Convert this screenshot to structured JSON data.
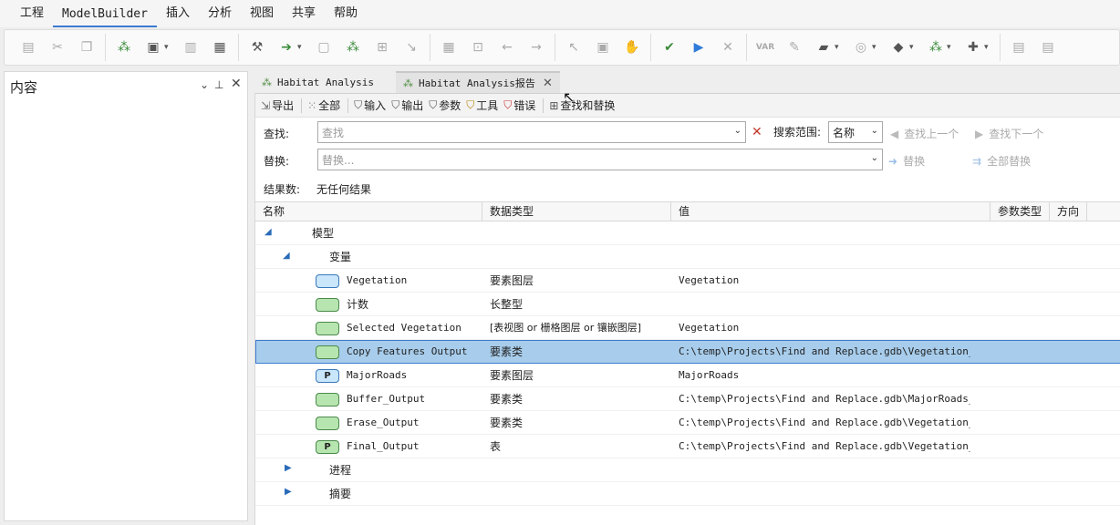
{
  "menubar": {
    "items": [
      "工程",
      "ModelBuilder",
      "插入",
      "分析",
      "视图",
      "共享",
      "帮助"
    ],
    "active": "ModelBuilder"
  },
  "contents_pane": {
    "title": "内容"
  },
  "tabs": [
    {
      "label": "Habitat Analysis",
      "active": false
    },
    {
      "label": "Habitat Analysis报告",
      "active": true
    }
  ],
  "report_toolbar": {
    "buttons": [
      "导出",
      "全部",
      "输入",
      "输出",
      "参数",
      "工具",
      "错误",
      "查找和替换"
    ]
  },
  "find": {
    "label": "查找:",
    "placeholder": "查找",
    "scope_label": "搜索范围:",
    "scope_value": "名称",
    "prev_label": "查找上一个",
    "next_label": "查找下一个"
  },
  "replace": {
    "label": "替换:",
    "placeholder": "替换...",
    "replace_label": "替换",
    "replace_all_label": "全部替换"
  },
  "results": {
    "label": "结果数:",
    "value": "无任何结果"
  },
  "grid": {
    "columns": [
      "名称",
      "数据类型",
      "值",
      "参数类型",
      "方向"
    ],
    "tree": {
      "model_label": "模型",
      "variables_label": "变量",
      "process_label": "进程",
      "summary_label": "摘要"
    },
    "rows": [
      {
        "name": "Vegetation",
        "datatype": "要素图层",
        "value": "Vegetation",
        "icon": "blue"
      },
      {
        "name": "计数",
        "datatype": "长整型",
        "value": "",
        "icon": "green"
      },
      {
        "name": "Selected Vegetation",
        "datatype": "[表视图 or 栅格图层 or 镶嵌图层]",
        "value": "Vegetation",
        "icon": "green"
      },
      {
        "name": "Copy Features Output",
        "datatype": "要素类",
        "value": "C:\\temp\\Projects\\Find and Replace.gdb\\Vegetation_Co…",
        "icon": "green",
        "selected": true
      },
      {
        "name": "MajorRoads",
        "datatype": "要素图层",
        "value": "MajorRoads",
        "icon": "blue-p"
      },
      {
        "name": "Buffer_Output",
        "datatype": "要素类",
        "value": "C:\\temp\\Projects\\Find and Replace.gdb\\MajorRoads_Bu…",
        "icon": "green"
      },
      {
        "name": "Erase_Output",
        "datatype": "要素类",
        "value": "C:\\temp\\Projects\\Find and Replace.gdb\\Vegetation_Co…",
        "icon": "green"
      },
      {
        "name": "Final_Output",
        "datatype": "表",
        "value": "C:\\temp\\Projects\\Find and Replace.gdb\\Vegetation_Co…",
        "icon": "green-p"
      }
    ]
  }
}
